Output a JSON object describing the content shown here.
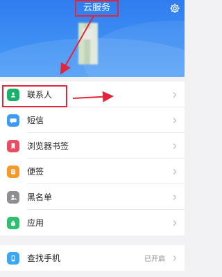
{
  "header": {
    "title": "云服务",
    "settings_icon": "gear-icon"
  },
  "items": [
    {
      "label": "联系人",
      "icon": "contacts-icon",
      "color": "#19b26a"
    },
    {
      "label": "短信",
      "icon": "message-icon",
      "color": "#3d9af5"
    },
    {
      "label": "浏览器书签",
      "icon": "bookmark-icon",
      "color": "#ea4d63"
    },
    {
      "label": "便签",
      "icon": "note-icon",
      "color": "#f39a2a"
    },
    {
      "label": "黑名单",
      "icon": "blacklist-icon",
      "color": "#8e8e93"
    },
    {
      "label": "应用",
      "icon": "android-icon",
      "color": "#2fbf71"
    }
  ],
  "find_phone": {
    "label": "查找手机",
    "status": "已开启",
    "icon": "phone-icon",
    "color": "#3aa7f3"
  }
}
